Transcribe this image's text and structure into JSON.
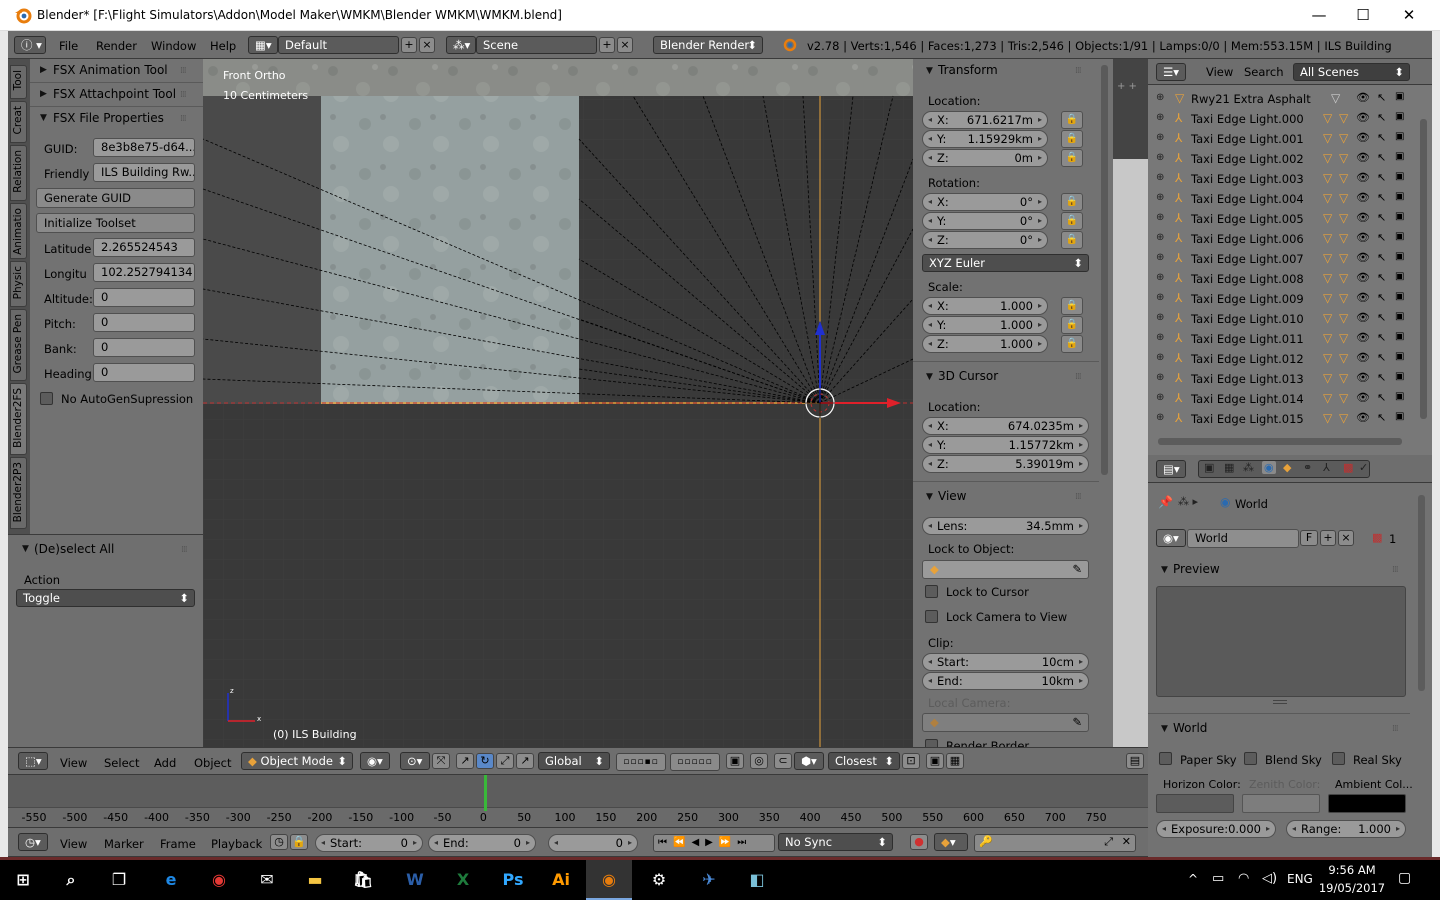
{
  "window": {
    "title": "Blender* [F:\\Flight Simulators\\Addon\\Model Maker\\WMKM\\Blender WMKM\\WMKM.blend]",
    "minimize": "—",
    "maximize": "☐",
    "close": "✕"
  },
  "info_header": {
    "menus": [
      "File",
      "Render",
      "Window",
      "Help"
    ],
    "layout": "Default",
    "scene": "Scene",
    "engine": "Blender Render",
    "stats": "v2.78 | Verts:1,546 | Faces:1,273 | Tris:2,546 | Objects:1/91 | Lamps:0/0 | Mem:553.15M | ILS Building"
  },
  "tool_tabs": [
    "Tool",
    "Creat",
    "Relation",
    "Animatio",
    "Physic",
    "Grease Pen",
    "Blender2FS",
    "Blender2P3"
  ],
  "fsx": {
    "anim_tool": "FSX Animation Tool",
    "attach_tool": "FSX Attachpoint Tool",
    "file_props": "FSX File Properties",
    "fields": [
      {
        "label": "GUID:",
        "value": "8e3b8e75-d64..."
      },
      {
        "label": "Friendly",
        "value": "ILS Building Rw..."
      }
    ],
    "generate_guid": "Generate GUID",
    "init_toolset": "Initialize Toolset",
    "coords": [
      {
        "label": "Latitude",
        "value": "2.265524543"
      },
      {
        "label": "Longitu",
        "value": "102.252794134"
      },
      {
        "label": "Altitude:",
        "value": "0"
      },
      {
        "label": "Pitch:",
        "value": "0"
      },
      {
        "label": "Bank:",
        "value": "0"
      },
      {
        "label": "Heading",
        "value": "0"
      }
    ],
    "no_autogen": "No AutoGenSupression"
  },
  "operator": {
    "title": "(De)select All",
    "action_label": "Action",
    "action_value": "Toggle"
  },
  "viewport": {
    "view_name": "Front Ortho",
    "scale_text": "10 Centimeters",
    "object_text": "(0) ILS Building"
  },
  "properties_n": {
    "transform": "Transform",
    "location_label": "Location:",
    "location": [
      {
        "axis": "X:",
        "value": "671.6217m"
      },
      {
        "axis": "Y:",
        "value": "1.15929km"
      },
      {
        "axis": "Z:",
        "value": "0m"
      }
    ],
    "rotation_label": "Rotation:",
    "rotation": [
      {
        "axis": "X:",
        "value": "0°"
      },
      {
        "axis": "Y:",
        "value": "0°"
      },
      {
        "axis": "Z:",
        "value": "0°"
      }
    ],
    "rotation_mode": "XYZ Euler",
    "scale_label": "Scale:",
    "scale": [
      {
        "axis": "X:",
        "value": "1.000"
      },
      {
        "axis": "Y:",
        "value": "1.000"
      },
      {
        "axis": "Z:",
        "value": "1.000"
      }
    ],
    "cursor": "3D Cursor",
    "cursor_location_label": "Location:",
    "cursor_location": [
      {
        "axis": "X:",
        "value": "674.0235m"
      },
      {
        "axis": "Y:",
        "value": "1.15772km"
      },
      {
        "axis": "Z:",
        "value": "5.39019m"
      }
    ],
    "view": "View",
    "lens_label": "Lens:",
    "lens_value": "34.5mm",
    "lock_to_object": "Lock to Object:",
    "lock_to_cursor": "Lock to Cursor",
    "lock_camera": "Lock Camera to View",
    "clip": "Clip:",
    "clip_start_label": "Start:",
    "clip_start": "10cm",
    "clip_end_label": "End:",
    "clip_end": "10km",
    "local_camera": "Local Camera:",
    "render_border": "Render Border"
  },
  "outliner": {
    "view": "View",
    "search": "Search",
    "filter": "All Scenes",
    "items": [
      "Rwy21 Extra Asphalt",
      "Taxi Edge Light.000",
      "Taxi Edge Light.001",
      "Taxi Edge Light.002",
      "Taxi Edge Light.003",
      "Taxi Edge Light.004",
      "Taxi Edge Light.005",
      "Taxi Edge Light.006",
      "Taxi Edge Light.007",
      "Taxi Edge Light.008",
      "Taxi Edge Light.009",
      "Taxi Edge Light.010",
      "Taxi Edge Light.011",
      "Taxi Edge Light.012",
      "Taxi Edge Light.013",
      "Taxi Edge Light.014",
      "Taxi Edge Light.015"
    ]
  },
  "world": {
    "breadcrumb": "World",
    "datablock": "World",
    "fake_user": "F",
    "users": "1",
    "preview": "Preview",
    "world_panel": "World",
    "paper_sky": "Paper Sky",
    "blend_sky": "Blend Sky",
    "real_sky": "Real Sky",
    "horizon": "Horizon Color:",
    "zenith": "Zenith Color:",
    "ambient": "Ambient Col...",
    "exposure_label": "Exposure:",
    "exposure": "0.000",
    "range_label": "Range:",
    "range": "1.000"
  },
  "view3d_header": {
    "menus": [
      "View",
      "Select",
      "Add",
      "Object"
    ],
    "mode": "Object Mode",
    "orientation": "Global",
    "snap": "Closest"
  },
  "timeline": {
    "ticks": [
      "-550",
      "-500",
      "-450",
      "-400",
      "-350",
      "-300",
      "-250",
      "-200",
      "-150",
      "-100",
      "-50",
      "0",
      "50",
      "100",
      "150",
      "200",
      "250",
      "300",
      "350",
      "400",
      "450",
      "500",
      "550",
      "600",
      "650",
      "700",
      "750"
    ],
    "menus": [
      "View",
      "Marker",
      "Frame",
      "Playback"
    ],
    "start_label": "Start:",
    "start": "0",
    "end_label": "End:",
    "end": "0",
    "current": "0",
    "sync": "No Sync"
  },
  "taskbar": {
    "lang": "ENG",
    "time": "9:56 AM",
    "date": "19/05/2017"
  },
  "colors": {
    "bg_panel": "#727272",
    "header": "#6e6e6e",
    "viewport": "#393939",
    "accent_orange": "#e8a23a",
    "x_axis": "#e0202a",
    "z_axis": "#2030d0",
    "frame_marker": "#39b839"
  }
}
